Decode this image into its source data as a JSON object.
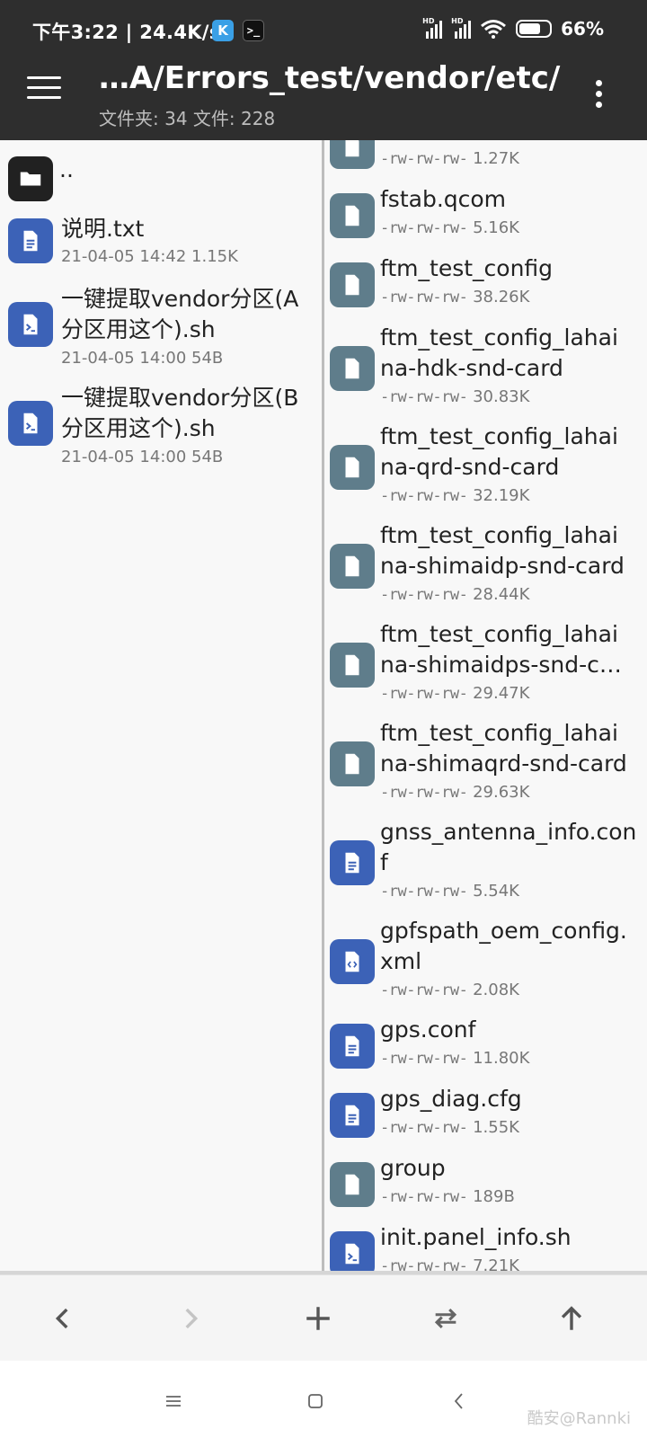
{
  "status_bar": {
    "time": "下午3:22 | 24.4K/s",
    "app_k": "K",
    "app_term": ">_",
    "sig1_label": "HD",
    "sig2_label": "HD",
    "battery_pct": "66%",
    "battery_level": 0.66
  },
  "toolbar": {
    "title": "…A/Errors_test/vendor/etc/",
    "subtitle": "文件夹: 34  文件: 228"
  },
  "left_pane": {
    "parent_dir": "..",
    "items": [
      {
        "name": "说明.txt",
        "meta": "21-04-05 14:42  1.15K",
        "icon": "document-icon"
      },
      {
        "name": "一键提取vendor分区(A分区用这个).sh",
        "line1": "一键提取vendor分区(A",
        "line2": "分区用这个).sh",
        "meta": "21-04-05 14:00  54B",
        "icon": "script-icon"
      },
      {
        "name": "一键提取vendor分区(B分区用这个).sh",
        "line1": "一键提取vendor分区(B",
        "line2": "分区用这个).sh",
        "meta": "21-04-05 14:00  54B",
        "icon": "script-icon"
      }
    ]
  },
  "right_pane": {
    "items": [
      {
        "line1": "",
        "line2": "",
        "perm": "-rw-rw-rw-",
        "size": "1.27K",
        "icon": "file-icon"
      },
      {
        "line1": "fstab.qcom",
        "line2": "",
        "perm": "-rw-rw-rw-",
        "size": "5.16K",
        "icon": "file-icon"
      },
      {
        "line1": "ftm_test_config",
        "line2": "",
        "perm": "-rw-rw-rw-",
        "size": "38.26K",
        "icon": "file-icon"
      },
      {
        "line1": "ftm_test_config_lahai",
        "line2": "na-hdk-snd-card",
        "perm": "-rw-rw-rw-",
        "size": "30.83K",
        "icon": "file-icon"
      },
      {
        "line1": "ftm_test_config_lahai",
        "line2": "na-qrd-snd-card",
        "perm": "-rw-rw-rw-",
        "size": "32.19K",
        "icon": "file-icon"
      },
      {
        "line1": "ftm_test_config_lahai",
        "line2": "na-shimaidp-snd-card",
        "perm": "-rw-rw-rw-",
        "size": "28.44K",
        "icon": "file-icon"
      },
      {
        "line1": "ftm_test_config_lahai",
        "line2": "na-shimaidps-snd-c…",
        "perm": "-rw-rw-rw-",
        "size": "29.47K",
        "icon": "file-icon"
      },
      {
        "line1": "ftm_test_config_lahai",
        "line2": "na-shimaqrd-snd-card",
        "perm": "-rw-rw-rw-",
        "size": "29.63K",
        "icon": "file-icon"
      },
      {
        "line1": "gnss_antenna_info.con",
        "line2": "f",
        "perm": "-rw-rw-rw-",
        "size": "5.54K",
        "icon": "document-icon"
      },
      {
        "line1": "gpfspath_oem_config.",
        "line2": "xml",
        "perm": "-rw-rw-rw-",
        "size": "2.08K",
        "icon": "xml-icon"
      },
      {
        "line1": "gps.conf",
        "line2": "",
        "perm": "-rw-rw-rw-",
        "size": "11.80K",
        "icon": "document-icon"
      },
      {
        "line1": "gps_diag.cfg",
        "line2": "",
        "perm": "-rw-rw-rw-",
        "size": "1.55K",
        "icon": "document-icon"
      },
      {
        "line1": "group",
        "line2": "",
        "perm": "-rw-rw-rw-",
        "size": "189B",
        "icon": "file-icon"
      },
      {
        "line1": "init.panel_info.sh",
        "line2": "",
        "perm": "-rw-rw-rw-",
        "size": "7.21K",
        "icon": "script-icon"
      }
    ]
  },
  "action_bar": {
    "buttons": [
      "back-icon",
      "forward-icon",
      "add-icon",
      "swap-icon",
      "up-icon"
    ]
  },
  "watermark": "酷安@Rannki",
  "colors": {
    "dark_bar": "#2e2e2e",
    "icon_blue": "#3c62b7",
    "icon_gray": "#5f7d8b",
    "icon_black": "#212121"
  }
}
